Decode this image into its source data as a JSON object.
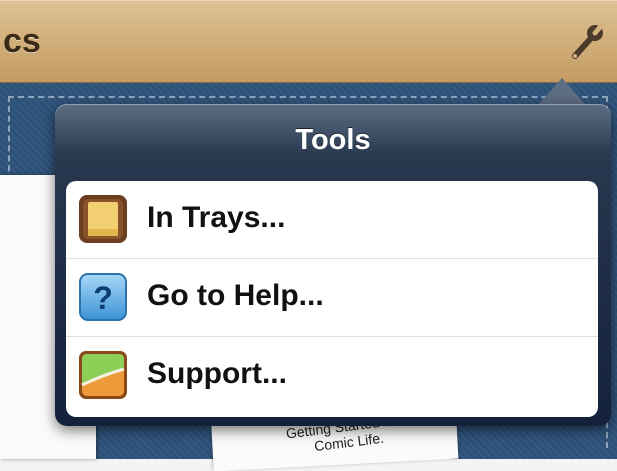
{
  "toolbar": {
    "title": "cs",
    "tools_icon": "wrench-icon"
  },
  "popover": {
    "title": "Tools"
  },
  "menu": {
    "items": [
      {
        "label": "In Trays...",
        "icon": "in-tray-icon"
      },
      {
        "label": "Go to Help...",
        "icon": "help-question-icon"
      },
      {
        "label": "Support...",
        "icon": "support-icon"
      }
    ]
  },
  "background_page": {
    "text_line1": "Getting Started with",
    "text_line2": "Comic Life."
  },
  "colors": {
    "toolbar_wood": "#d3b17d",
    "desk_denim": "#2d4f74",
    "popover_navy": "#13213a",
    "menu_background": "#ffffff"
  }
}
